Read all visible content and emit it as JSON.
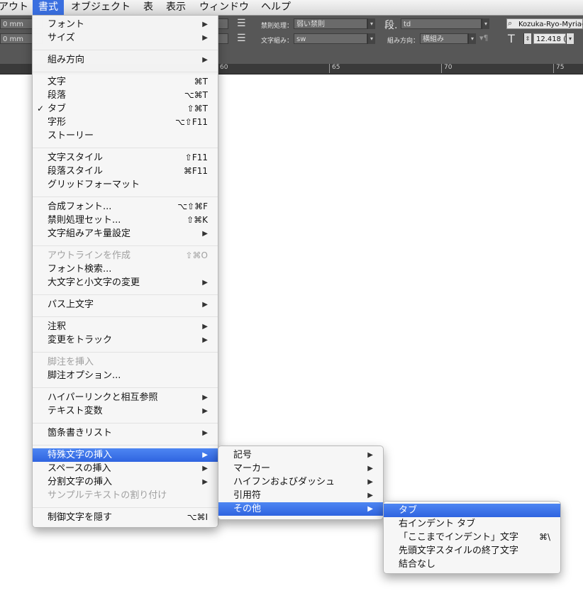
{
  "menubar": {
    "items": [
      {
        "label": "アウト"
      },
      {
        "label": "書式"
      },
      {
        "label": "オブジェクト"
      },
      {
        "label": "表"
      },
      {
        "label": "表示"
      },
      {
        "label": "ウィンドウ"
      },
      {
        "label": "ヘルプ"
      }
    ]
  },
  "control_panel": {
    "mm1": "0 mm",
    "mm2": "0 mm",
    "kinsoku_label": "禁則処理：",
    "kinsoku_value": "弱い禁則",
    "mojigumi_label": "文字組み：",
    "mojigumi_value": "sw",
    "dan_label": "段.",
    "dan_value": "td",
    "kumihoukou_label": "組み方向：",
    "kumihoukou_value": "横組み",
    "font_value": "Kozuka-Ryo-Myriad",
    "size_value": "12.418 ("
  },
  "ruler": {
    "labels": [
      "60",
      "65",
      "70",
      "75"
    ]
  },
  "menu": {
    "groups": [
      [
        {
          "label": "フォント",
          "arrow": true
        },
        {
          "label": "サイズ",
          "arrow": true
        }
      ],
      [
        {
          "label": "組み方向",
          "arrow": true
        }
      ],
      [
        {
          "label": "文字",
          "shortcut": "⌘T"
        },
        {
          "label": "段落",
          "shortcut": "⌥⌘T"
        },
        {
          "label": "タブ",
          "shortcut": "⇧⌘T",
          "checked": true
        },
        {
          "label": "字形",
          "shortcut": "⌥⇧F11"
        },
        {
          "label": "ストーリー"
        }
      ],
      [
        {
          "label": "文字スタイル",
          "shortcut": "⇧F11"
        },
        {
          "label": "段落スタイル",
          "shortcut": "⌘F11"
        },
        {
          "label": "グリッドフォーマット"
        }
      ],
      [
        {
          "label": "合成フォント...",
          "shortcut": "⌥⇧⌘F"
        },
        {
          "label": "禁則処理セット...",
          "shortcut": "⇧⌘K"
        },
        {
          "label": "文字組みアキ量設定",
          "arrow": true
        }
      ],
      [
        {
          "label": "アウトラインを作成",
          "shortcut": "⇧⌘O",
          "disabled": true
        },
        {
          "label": "フォント検索..."
        },
        {
          "label": "大文字と小文字の変更",
          "arrow": true
        }
      ],
      [
        {
          "label": "パス上文字",
          "arrow": true
        }
      ],
      [
        {
          "label": "注釈",
          "arrow": true
        },
        {
          "label": "変更をトラック",
          "arrow": true
        }
      ],
      [
        {
          "label": "脚注を挿入",
          "disabled": true
        },
        {
          "label": "脚注オプション..."
        }
      ],
      [
        {
          "label": "ハイパーリンクと相互参照",
          "arrow": true
        },
        {
          "label": "テキスト変数",
          "arrow": true
        }
      ],
      [
        {
          "label": "箇条書きリスト",
          "arrow": true
        }
      ],
      [
        {
          "label": "特殊文字の挿入",
          "arrow": true,
          "highlighted": true
        },
        {
          "label": "スペースの挿入",
          "arrow": true
        },
        {
          "label": "分割文字の挿入",
          "arrow": true
        },
        {
          "label": "サンプルテキストの割り付け",
          "disabled": true
        }
      ],
      [
        {
          "label": "制御文字を隠す",
          "shortcut": "⌥⌘I"
        }
      ]
    ]
  },
  "submenu1": {
    "items": [
      {
        "label": "記号",
        "arrow": true
      },
      {
        "label": "マーカー",
        "arrow": true
      },
      {
        "label": "ハイフンおよびダッシュ",
        "arrow": true
      },
      {
        "label": "引用符",
        "arrow": true
      },
      {
        "label": "その他",
        "arrow": true,
        "highlighted": true
      }
    ]
  },
  "submenu2": {
    "items": [
      {
        "label": "タブ",
        "highlighted": true
      },
      {
        "label": "右インデント タブ"
      },
      {
        "label": "「ここまでインデント」文字",
        "shortcut": "⌘\\"
      },
      {
        "label": "先頭文字スタイルの終了文字"
      },
      {
        "label": "結合なし"
      }
    ]
  },
  "colors": {
    "highlight": "#3a6fe0",
    "panel": "#575757"
  }
}
